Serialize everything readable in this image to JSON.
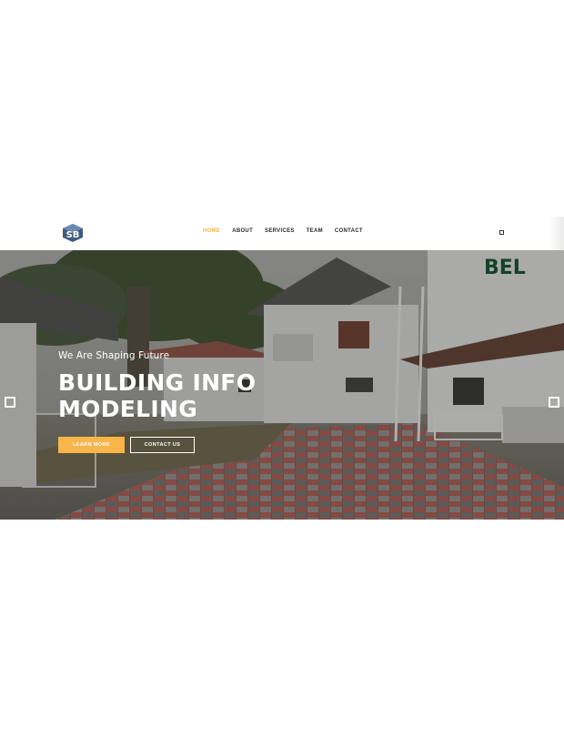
{
  "nav": {
    "items": [
      {
        "label": "HOME",
        "active": true
      },
      {
        "label": "ABOUT",
        "active": false
      },
      {
        "label": "SERVICES",
        "active": false
      },
      {
        "label": "TEAM",
        "active": false
      },
      {
        "label": "CONTACT",
        "active": false
      }
    ]
  },
  "hero": {
    "subtitle": "We Are Shaping Future",
    "headline_line1": "BUILDING INFO",
    "headline_line2": "MODELING",
    "learn_label": "LEARN MORE",
    "contact_label": "CONTACT US"
  },
  "colors": {
    "accent": "#f7b54a",
    "nav_active": "#f3b34a",
    "text_dark": "#2a2a2a"
  },
  "icons": {
    "logo": "sb-logo",
    "menu": "menu-square-icon",
    "prev": "prev-arrow-icon",
    "next": "next-arrow-icon"
  }
}
